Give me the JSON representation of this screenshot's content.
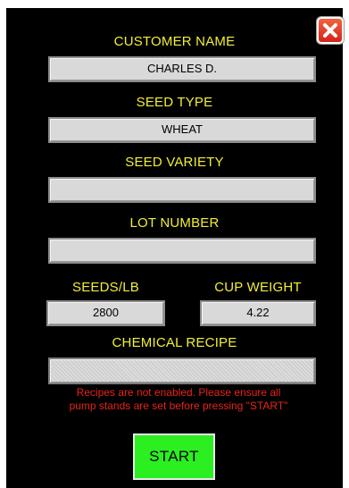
{
  "close_button": {
    "icon": "close-icon",
    "color": "#e0321f"
  },
  "customer_name": {
    "label": "CUSTOMER NAME",
    "value": "CHARLES D."
  },
  "seed_type": {
    "label": "SEED TYPE",
    "value": "WHEAT"
  },
  "seed_variety": {
    "label": "SEED VARIETY",
    "value": ""
  },
  "lot_number": {
    "label": "LOT NUMBER",
    "value": ""
  },
  "seeds_per_lb": {
    "label": "SEEDS/LB",
    "value": "2800"
  },
  "cup_weight": {
    "label": "CUP WEIGHT",
    "value": "4.22"
  },
  "chemical_recipe": {
    "label": "CHEMICAL RECIPE",
    "value": "",
    "enabled": false
  },
  "warning": {
    "line1": "Recipes are not enabled.  Please ensure all",
    "line2": "pump stands are set before pressing \"START\""
  },
  "start_button": {
    "label": "START",
    "color": "#2bef21"
  },
  "colors": {
    "label": "#f2ef33",
    "background": "#000000",
    "warning": "#e8231c"
  }
}
